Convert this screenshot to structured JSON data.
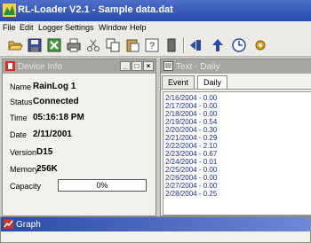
{
  "window": {
    "title": "RL-Loader V2.1 - Sample data.dat"
  },
  "menu": [
    "File",
    "Edit",
    "Logger",
    "Settings",
    "Window",
    "Help"
  ],
  "toolbar": {
    "icons": [
      "open-folder-icon",
      "save-icon",
      "spreadsheet-icon",
      "print-icon",
      "cut-icon",
      "copy-icon",
      "paste-icon",
      "help-icon",
      "device-icon",
      "download-icon",
      "upload-icon",
      "clock-icon",
      "settings-icon"
    ]
  },
  "device_info": {
    "title": "Device Info",
    "fields": [
      {
        "label": "Name",
        "value": "RainLog 1"
      },
      {
        "label": "Status",
        "value": "Connected"
      },
      {
        "label": "Time",
        "value": "05:16:18 PM"
      },
      {
        "label": "Date",
        "value": "2/11/2001"
      },
      {
        "label": "Version",
        "value": "D15"
      },
      {
        "label": "Memory",
        "value": "256K"
      }
    ],
    "capacity": {
      "label": "Capacity",
      "text": "0%",
      "fraction": 0.0
    }
  },
  "text_daily": {
    "title": "Text - Daily",
    "tabs": [
      "Event",
      "Daily"
    ],
    "active_tab": "Daily",
    "entries": [
      "2/16/2004 - 0.00",
      "2/17/2004 - 0.00",
      "2/18/2004 - 0.00",
      "2/19/2004 - 0.54",
      "2/20/2004 - 0.30",
      "2/21/2004 - 0.29",
      "2/22/2004 - 2.10",
      "2/23/2004 - 0.67",
      "2/24/2004 - 0.01",
      "2/25/2004 - 0.00",
      "2/26/2004 - 0.00",
      "2/27/2004 - 0.00",
      "2/28/2004 - 0.25"
    ]
  },
  "graph": {
    "title": "Graph"
  },
  "colors": {
    "titlebar": "#2a4aa8",
    "accent": "#1f3fa0",
    "entry_text": "#1b2f8a"
  }
}
